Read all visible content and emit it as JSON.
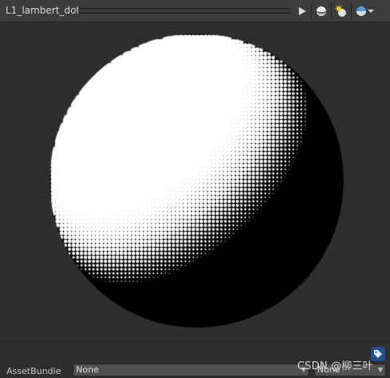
{
  "header": {
    "title": "L1_lambert_dot",
    "toolbar": [
      {
        "name": "play-icon"
      },
      {
        "name": "sphere-shape-icon"
      },
      {
        "name": "light-toggle-icon"
      },
      {
        "name": "sky-sphere-icon"
      },
      {
        "name": "chevron-down-icon"
      }
    ]
  },
  "preview": {
    "subject": "halftone-lit-sphere",
    "light_from": "upper-left",
    "colors": {
      "lit": "#ffffff",
      "shadow": "#000000",
      "background": "#2e2e2e"
    }
  },
  "footer": {
    "asset_bundle_label": "AssetBundle",
    "bundle_name": "None",
    "bundle_variant": "None",
    "watermark": "CSDN @柳三叶",
    "tag_icon": "tag-icon",
    "colors": {
      "tag_button": "#1d4f91"
    }
  }
}
